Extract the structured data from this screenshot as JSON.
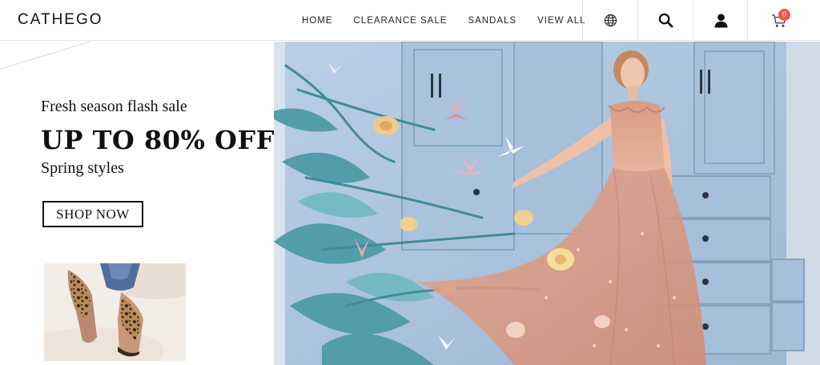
{
  "brand": {
    "name": "CATHEGO"
  },
  "nav": {
    "items": [
      {
        "label": "HOME"
      },
      {
        "label": "CLEARANCE SALE"
      },
      {
        "label": "SANDALS"
      },
      {
        "label": "VIEW ALL"
      }
    ]
  },
  "header_icons": {
    "language": "globe-icon",
    "search": "search-icon",
    "account": "user-icon",
    "cart": "cart-icon",
    "cart_count": "0",
    "badge_color": "#f0544f"
  },
  "promo": {
    "kicker": "Fresh season flash sale",
    "headline": "UP TO 80% OFF",
    "subline": "Spring styles",
    "cta_label": "SHOP NOW"
  }
}
